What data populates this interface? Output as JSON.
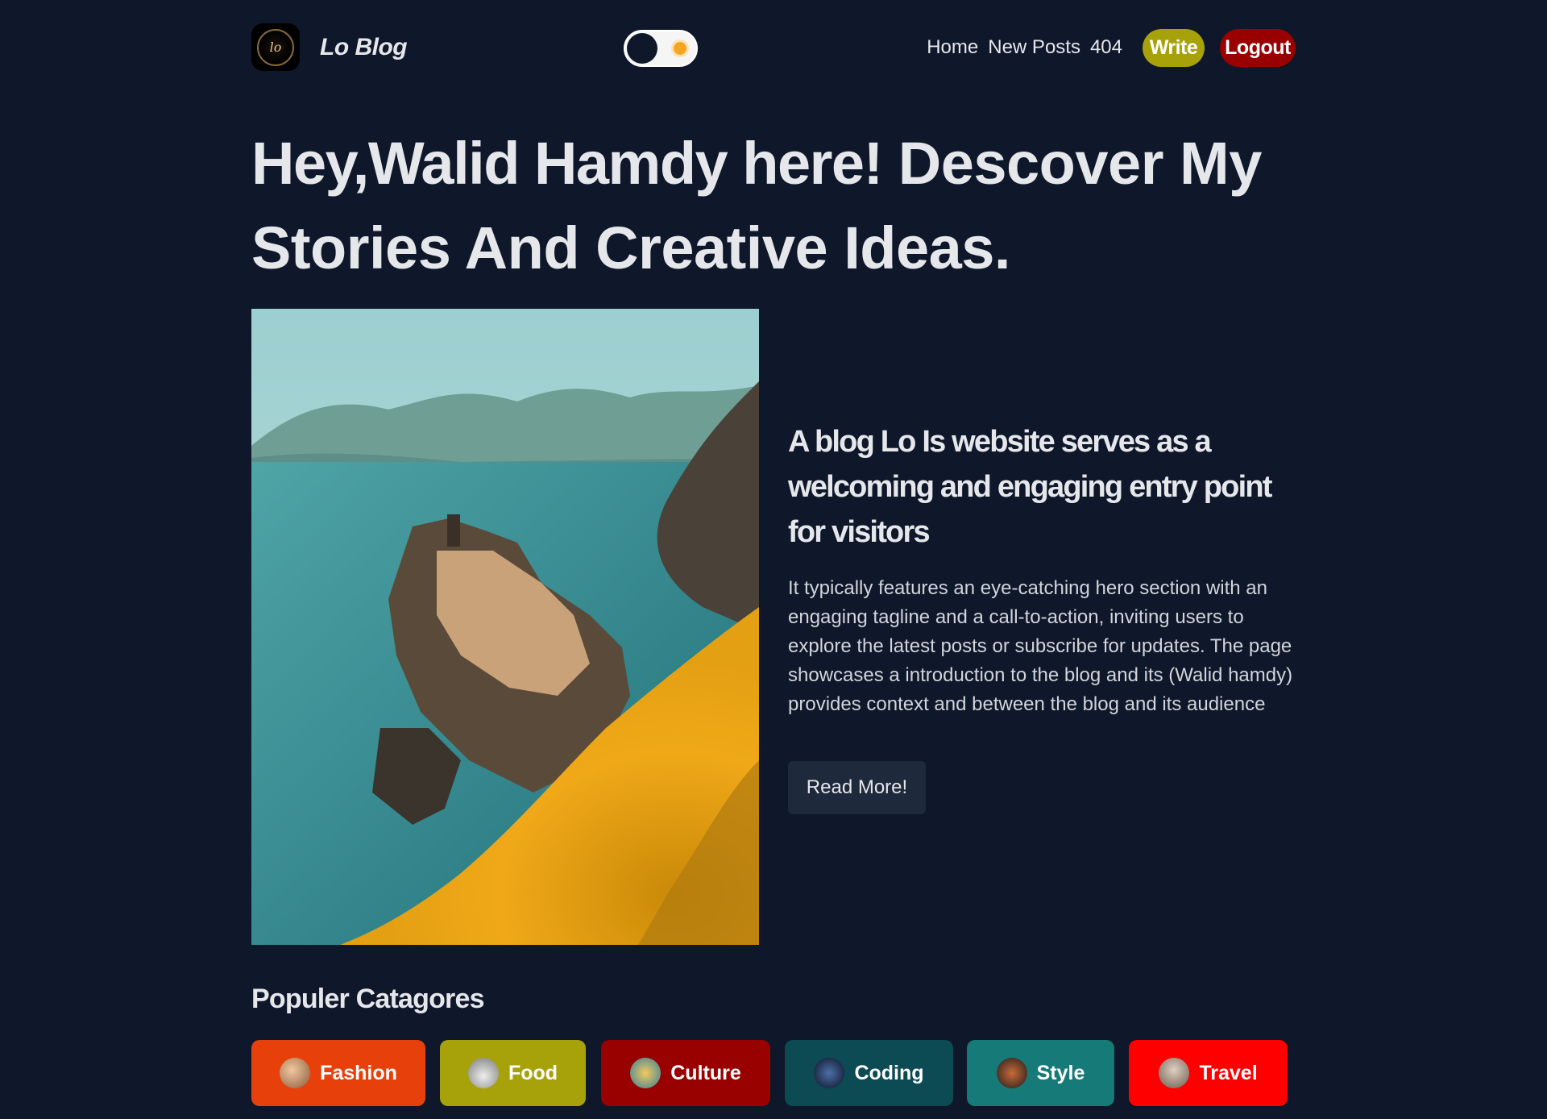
{
  "nav": {
    "brand": "Lo Blog",
    "logo_icon": "lo-monogram-logo",
    "toggle_icons": [
      "moon-knob",
      "sun-icon"
    ],
    "links": [
      "Home",
      "New Posts",
      "404"
    ],
    "write_label": "Write",
    "logout_label": "Logout",
    "colors": {
      "write": "#a8a20a",
      "logout": "#990000"
    }
  },
  "hero": {
    "title_bold": "Hey,Walid Hamdy here!",
    "title_rest": " Descover My Stories And Creative Ideas."
  },
  "feature": {
    "image_alt": "cliffside-village-photo",
    "title": "A blog Lo Is website serves as a welcoming and engaging entry point for visitors",
    "description": "It typically features an eye-catching hero section with an engaging tagline and a call-to-action, inviting users to explore the latest posts or subscribe for updates. The page showcases a introduction to the blog and its (Walid hamdy) provides context and between the blog and its audience",
    "button_label": "Read More!"
  },
  "categories": {
    "heading": "Populer Catagores",
    "items": [
      {
        "label": "Fashion",
        "color": "#e8400b"
      },
      {
        "label": "Food",
        "color": "#a8a20a"
      },
      {
        "label": "Culture",
        "color": "#990000"
      },
      {
        "label": "Coding",
        "color": "#0c4a54"
      },
      {
        "label": "Style",
        "color": "#167a78"
      },
      {
        "label": "Travel",
        "color": "#ff0000"
      }
    ]
  }
}
